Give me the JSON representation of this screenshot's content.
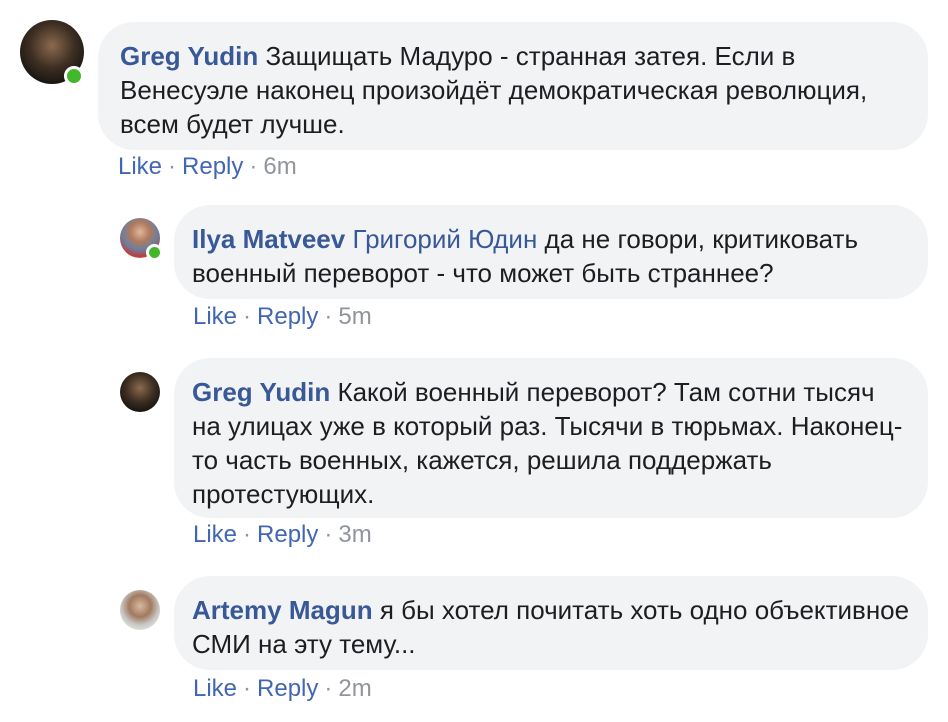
{
  "comments": [
    {
      "author": "Greg Yudin",
      "mention": "",
      "text": "Защищать Мадуро - странная затея. Если в Венесуэле наконец произойдёт демократическая революция, всем будет лучше.",
      "like": "Like",
      "reply": "Reply",
      "time": "6m",
      "online": true
    },
    {
      "author": "Ilya Matveev",
      "mention": "Григорий Юдин",
      "text": "да не говори, критиковать военный переворот - что может быть страннее?",
      "like": "Like",
      "reply": "Reply",
      "time": "5m",
      "online": true
    },
    {
      "author": "Greg Yudin",
      "mention": "",
      "text": "Какой военный переворот? Там сотни тысяч на улицах уже в который раз. Тысячи в тюрьмах. Наконец-то часть военных, кажется, решила поддержать протестующих.",
      "like": "Like",
      "reply": "Reply",
      "time": "3m",
      "online": false
    },
    {
      "author": "Artemy Magun",
      "mention": "",
      "text": "я бы хотел почитать хоть одно объективное СМИ на эту тему...",
      "like": "Like",
      "reply": "Reply",
      "time": "2m",
      "online": false
    }
  ],
  "separator": "·",
  "colors": {
    "link": "#385898",
    "bubble": "#f2f3f5",
    "online": "#42b72a",
    "meta": "#90949c"
  }
}
